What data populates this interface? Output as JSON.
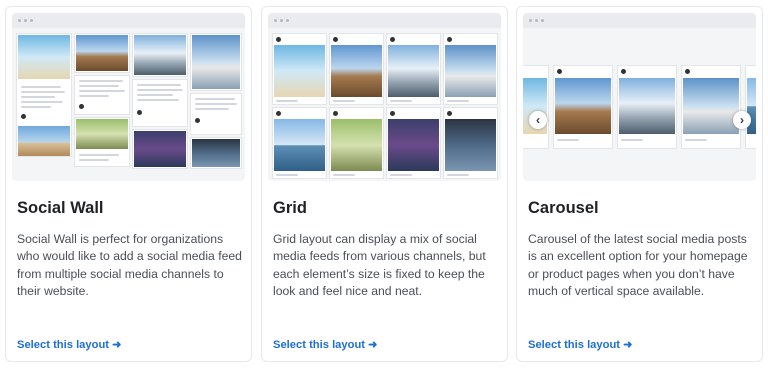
{
  "cards": [
    {
      "title": "Social Wall",
      "description": "Social Wall is perfect for organizations who would like to add a social media feed from multiple social media channels to their website.",
      "cta": "Select this layout"
    },
    {
      "title": "Grid",
      "description": "Grid layout can display a mix of social media feeds from various channels, but each element’s size is fixed to keep the look and feel nice and neat.",
      "cta": "Select this layout"
    },
    {
      "title": "Carousel",
      "description": "Carousel of the latest social media posts is an excellent option for your homepage or product pages when you don’t have much of vertical space available.",
      "cta": "Select this layout"
    }
  ],
  "carousel_nav": {
    "prev": "‹",
    "next": "›"
  },
  "colors": {
    "link": "#1d6fd6",
    "title": "#1f2126",
    "body": "#4a4e57",
    "border": "#e6e8ec"
  }
}
